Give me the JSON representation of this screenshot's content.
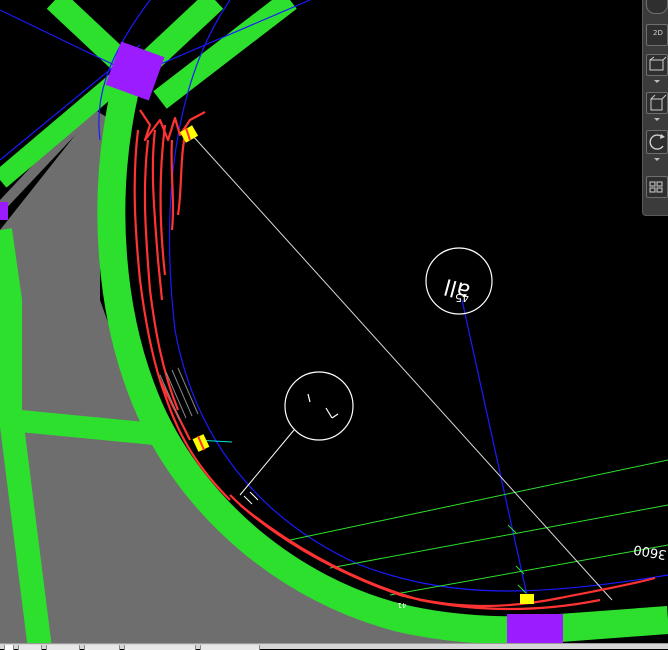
{
  "drawing": {
    "dimension_text": "3600",
    "bubble_text_main": "all",
    "bubble_text_sub": "45",
    "small_label": "41"
  },
  "toolbar": {
    "view_label": "2D",
    "icons": [
      "viewcube-icon",
      "view-2d-icon",
      "box-view-icon",
      "cube-view-icon",
      "orbit-icon",
      "showmotion-icon"
    ]
  },
  "colors": {
    "background": "#000000",
    "road_green": "#2ee02e",
    "gray_fill": "#6e6e6e",
    "purple_node": "#9a1cff",
    "red_sketch": "#ff3333",
    "blue_line": "#1a1aff",
    "yellow_marker": "#ffff00"
  }
}
